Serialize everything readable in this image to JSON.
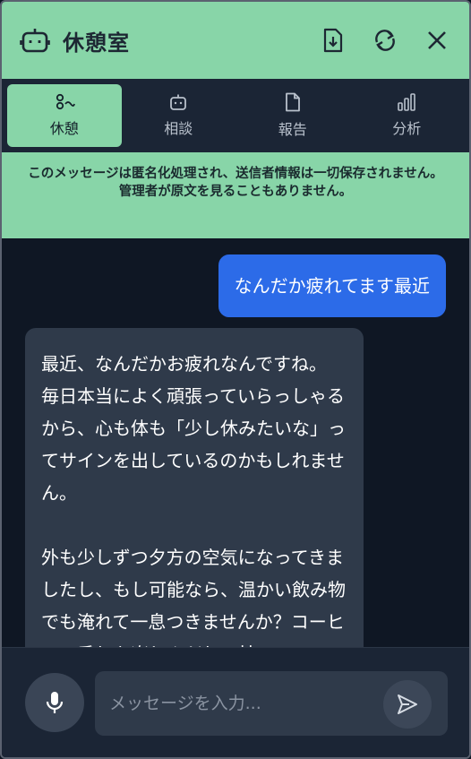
{
  "header": {
    "title": "休憩室",
    "icons": [
      "robot-icon",
      "download-icon",
      "refresh-icon",
      "close-icon"
    ]
  },
  "tabs": [
    {
      "label": "休憩",
      "icon": "relax-icon",
      "active": true
    },
    {
      "label": "相談",
      "icon": "robot-icon",
      "active": false
    },
    {
      "label": "報告",
      "icon": "document-icon",
      "active": false
    },
    {
      "label": "分析",
      "icon": "bar-chart-icon",
      "active": false
    }
  ],
  "notice": {
    "line1": "このメッセージは匿名化処理され、送信者情報は一切保存されません。",
    "line2": "管理者が原文を見ることもありません。"
  },
  "messages": {
    "user": "なんだか疲れてます最近",
    "bot": "最近、なんだかお疲れなんですね。\n毎日本当によく頑張っていらっしゃるから、心も体も「少し休みたいな」ってサインを出しているのかもしれません。\n\n外も少しずつ夕方の空気になってきましたし、もし可能なら、温かい飲み物でも淹れて一息つきませんか？コーヒーの香りを楽しんだり、甘いココアでホッとしたり"
  },
  "input": {
    "placeholder": "メッセージを入力..."
  },
  "colors": {
    "accent": "#88d5a8",
    "background": "#0f1724",
    "panel": "#1b2535",
    "user_bubble": "#2c6be8",
    "bot_bubble": "#2f3a4a"
  }
}
